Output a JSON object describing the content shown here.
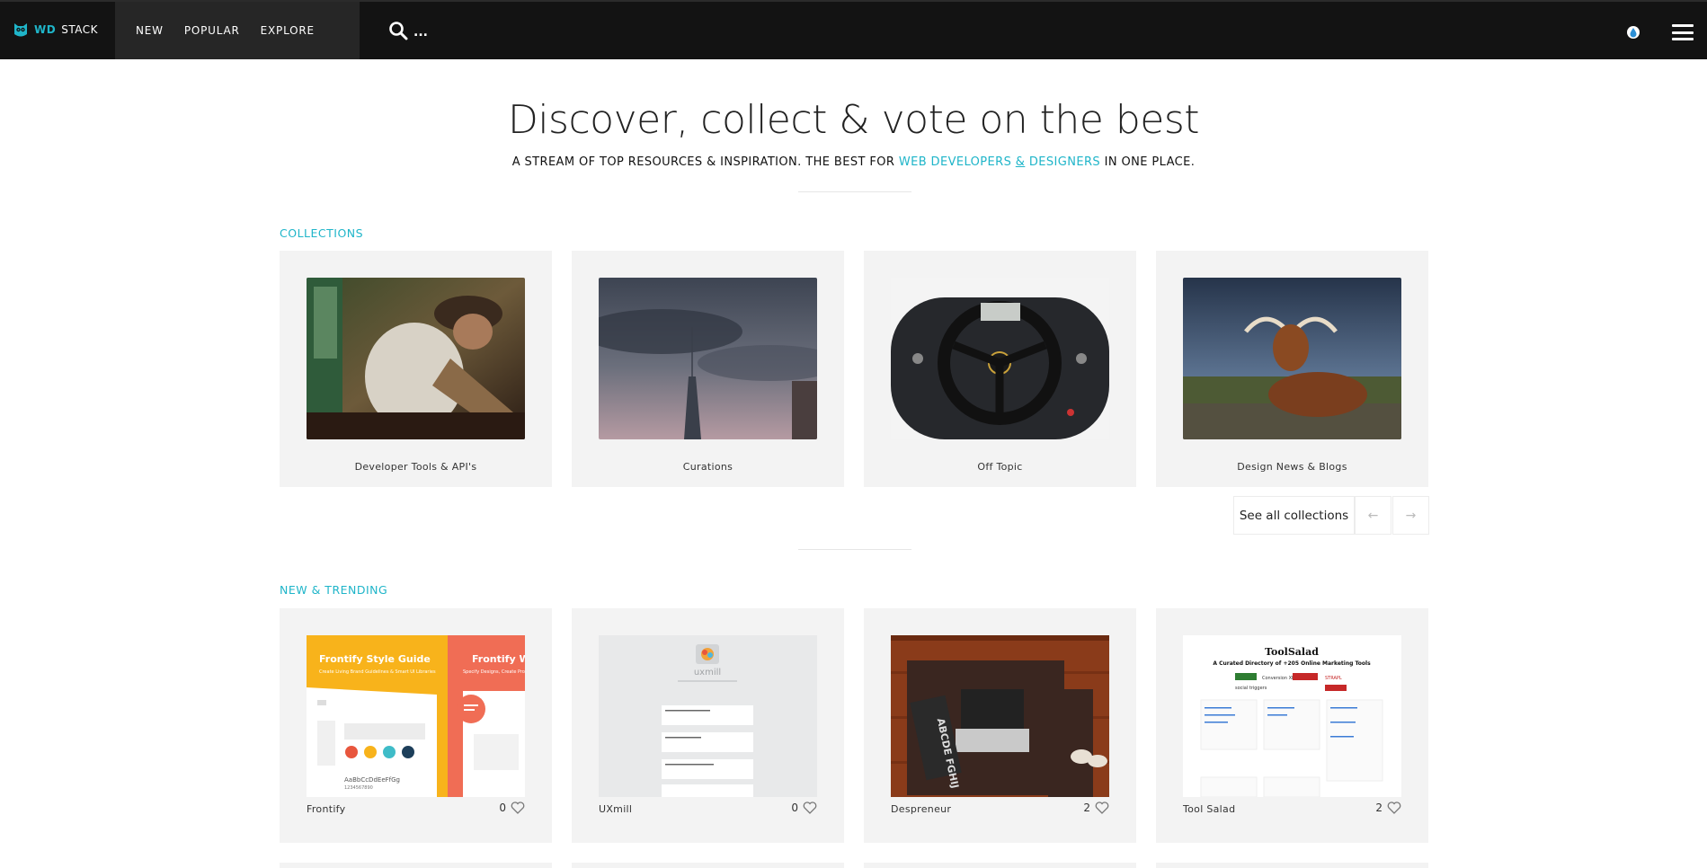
{
  "brand": {
    "wd": "WD",
    "stack": "STACK"
  },
  "nav": {
    "items": [
      "NEW",
      "POPULAR",
      "EXPLORE"
    ]
  },
  "search": {
    "placeholder": "..."
  },
  "hero": {
    "title": "Discover, collect & vote on the best",
    "sub_prefix": "A STREAM OF TOP RESOURCES & INSPIRATION. THE BEST FOR ",
    "sub_hl1": "WEB DEVELOPERS",
    "sub_amp": "&",
    "sub_hl2": "DESIGNERS",
    "sub_suffix": " IN ONE PLACE."
  },
  "collections": {
    "label": "COLLECTIONS",
    "items": [
      {
        "title": "Developer Tools & API's"
      },
      {
        "title": "Curations"
      },
      {
        "title": "Off Topic"
      },
      {
        "title": "Design News & Blogs"
      }
    ],
    "see_all": "See all collections",
    "prev_icon": "←",
    "next_icon": "→"
  },
  "trending": {
    "label": "NEW & TRENDING",
    "items": [
      {
        "name": "Frontify",
        "votes": "0",
        "thumb_text_a": "Frontify Style Guide",
        "thumb_text_b": "Frontify W",
        "thumb_sub_a": "Create Living Brand Guidelines & Smart UI Libraries",
        "thumb_sub_b": "Specify Designs, Create Pro",
        "thumb_sample": "AaBbCcDdEeFfGg",
        "thumb_digits": "1234567890"
      },
      {
        "name": "UXmill",
        "votes": "0",
        "thumb_text": "uxmill"
      },
      {
        "name": "Despreneur",
        "votes": "2",
        "pillow_text": "ABCDE FGHIJ"
      },
      {
        "name": "Tool Salad",
        "votes": "2",
        "thumb_title": "ToolSalad",
        "thumb_sub": "A Curated Directory of +205 Online Marketing Tools",
        "badge_b": "Conversion XL",
        "badge_c": "STRAPL",
        "thumb_tag": "social triggers"
      }
    ]
  },
  "colors": {
    "accent": "#1fb5c9",
    "topbar": "#131313",
    "nav_bg": "#262626",
    "card_bg": "#f3f3f3"
  }
}
